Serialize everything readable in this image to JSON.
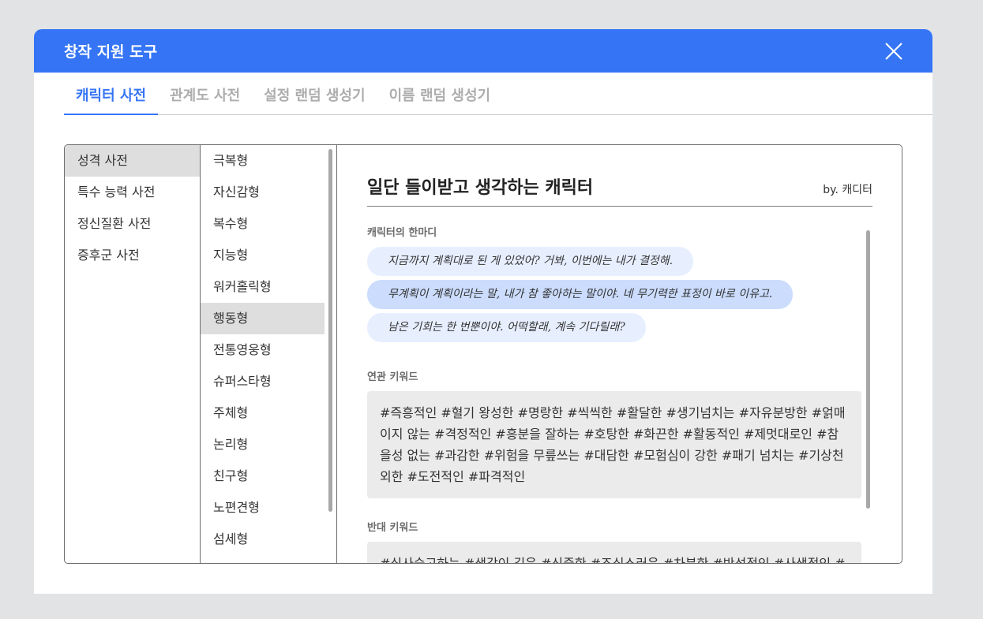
{
  "window": {
    "title": "창작 지원 도구"
  },
  "tabs": [
    {
      "label": "캐릭터 사전",
      "active": true
    },
    {
      "label": "관계도 사전",
      "active": false
    },
    {
      "label": "설정 랜덤 생성기",
      "active": false
    },
    {
      "label": "이름 랜덤 생성기",
      "active": false
    }
  ],
  "categories": [
    "성격 사전",
    "특수 능력 사전",
    "정신질환 사전",
    "증후군 사전"
  ],
  "types": [
    "극복형",
    "자신감형",
    "복수형",
    "지능형",
    "워커홀릭형",
    "행동형",
    "전통영웅형",
    "슈퍼스타형",
    "주체형",
    "논리형",
    "친구형",
    "노편견형",
    "섬세형"
  ],
  "detail": {
    "title": "일단 들이받고 생각하는 캐릭터",
    "author": "by. 캐디터",
    "quotes_label": "캐릭터의 한마디",
    "quotes": [
      "지금까지 계획대로 된 게 있었어? 거봐, 이번에는 내가 결정해.",
      "무계획이 계획이라는 말, 내가 참 좋아하는 말이야. 네 무기력한 표정이 바로 이유고.",
      "남은 기회는 한 번뿐이야. 어떡할래, 계속 기다릴래?"
    ],
    "related_label": "연관 키워드",
    "related_text": "#즉흥적인 #혈기 왕성한 #명랑한 #씩씩한 #활달한 #생기넘치는 #자유분방한 #얽매이지 않는 #격정적인 #흥분을 잘하는 #호탕한 #화끈한 #활동적인 #제멋대로인 #참을성 없는 #과감한 #위험을 무릎쓰는 #대담한 #모험심이 강한 #패기 넘치는 #기상천외한 #도전적인 #파격적인",
    "opposite_label": "반대 키워드",
    "opposite_text": "#심사숙고하는 #생각이 깊은 #신중한 #조심스러운 #차분한 #반성적인 #사색적인 #"
  },
  "colors": {
    "accent": "#3575f5",
    "bubble_light": "#e7efff",
    "bubble_mid": "#cbdcfd"
  }
}
